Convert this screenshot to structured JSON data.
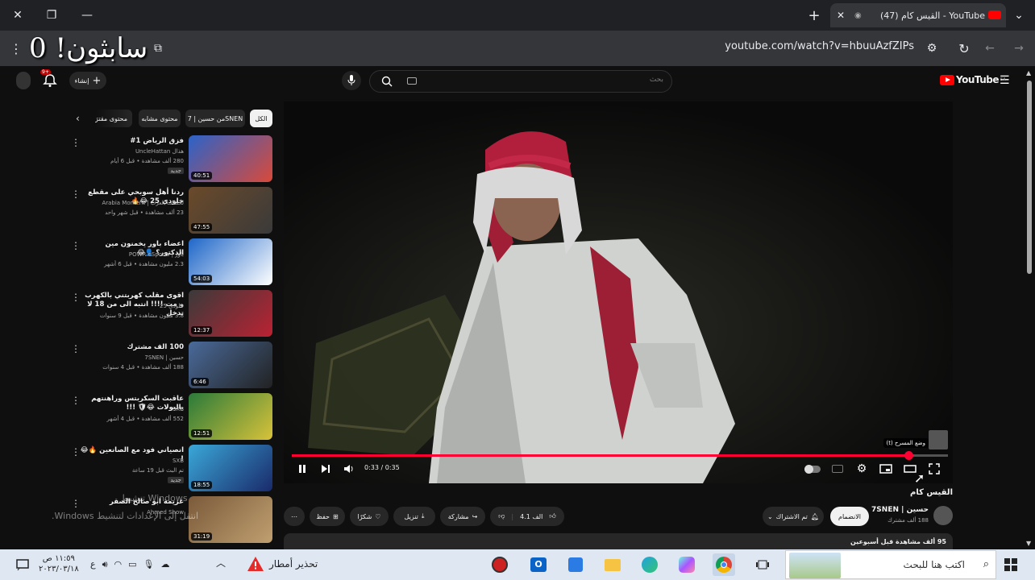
{
  "browser": {
    "tab_title": "(47) القيس كام - YouTube",
    "url": "youtube.com/watch?v=hbuuAzfZIPs",
    "overlay_text": "سابثون! 0"
  },
  "yt_header": {
    "logo_text": "YouTube",
    "logo_sup": "SA",
    "search_placeholder": "بحث",
    "create_label": "إنشاء",
    "notif_count": "9+"
  },
  "chips": [
    "الكل",
    "من حسين | 7SNEN",
    "محتوى مشابه",
    "محتوى مقترَح"
  ],
  "recommendations": [
    {
      "title": "فزق الرياض 1#",
      "channel": "هذال UncleHattan",
      "views": "280 ألف مشاهدة • قبل 6 أيام",
      "badge": "جديد",
      "duration": "40:51"
    },
    {
      "title": "ردنا أهل سوبحي على مقطع خلودي 25 😂🔥",
      "channel": "لحظات العرب | Arabia Moment",
      "views": "23 ألف مشاهدة • قبل شهر واحد",
      "badge": "",
      "duration": "47:55"
    },
    {
      "title": "اعضاء باور يخمنون مين الدكتور؟ 👤😂",
      "channel": "باور | POWR eSports",
      "views": "2.3 مليون مشاهدة • قبل 6 أشهر",
      "badge": "",
      "duration": "54:03"
    },
    {
      "title": "اقوى مقلب كهربتني بالكهرب و مت !!!! انتبه الى من 18 لا تدخل",
      "channel": "خلودي 25",
      "views": "3.8 مليون مشاهدة • قبل 9 سنوات",
      "badge": "",
      "duration": "12:37"
    },
    {
      "title": "100 الف مشترك",
      "channel": "حسين | 7SNEN",
      "views": "188 ألف مشاهدة • قبل 4 سنوات",
      "badge": "",
      "duration": "6:46"
    },
    {
      "title": "عاقبت السكربتس وراهنتهم بالبولات 😂🛡 !!!",
      "channel": "SXB",
      "views": "552 ألف مشاهدة • قبل 4 أشهر",
      "badge": "",
      "duration": "12:51"
    },
    {
      "title": "انصياني فود مع الصانعين 🔥😂 !",
      "channel": "SXB",
      "views": "تم البث قبل 19 ساعة",
      "badge": "جديد",
      "duration": "18:55"
    },
    {
      "title": "عزيمة ابو صالح الصقر",
      "channel": "Ahmed Show",
      "views": "",
      "badge": "",
      "duration": "31:19"
    }
  ],
  "player": {
    "time": "0:33 / 0:35",
    "progress": 0.94,
    "badge_text": "وضع المسرح (t)"
  },
  "video": {
    "title": "القيس كام",
    "channel": "حسين | 7SNEN",
    "subs": "188 ألف مشترك",
    "join_label": "الانضمام",
    "subscribed_label": "تم الاشتراك",
    "likes": "4.1 الف",
    "share_label": "مشاركة",
    "download_label": "تنزيل",
    "thanks_label": "شكرًا",
    "save_label": "حفظ",
    "meta": "95 ألف مشاهدة قبل أسبوعين"
  },
  "windows_watermark": {
    "line1": "تنشيط Windows",
    "line2": "انتقل إلى الإعدادات لتنشيط Windows."
  },
  "taskbar": {
    "search_placeholder": "اكتب هنا للبحث",
    "weather": "تحذير أمطار",
    "time": "١١:٥٩ ص",
    "date": "٢٠٢٣/٠٣/١٨",
    "lang": "ع"
  },
  "colors": {
    "accent_red": "#ff0000",
    "progress_red": "#f03"
  }
}
